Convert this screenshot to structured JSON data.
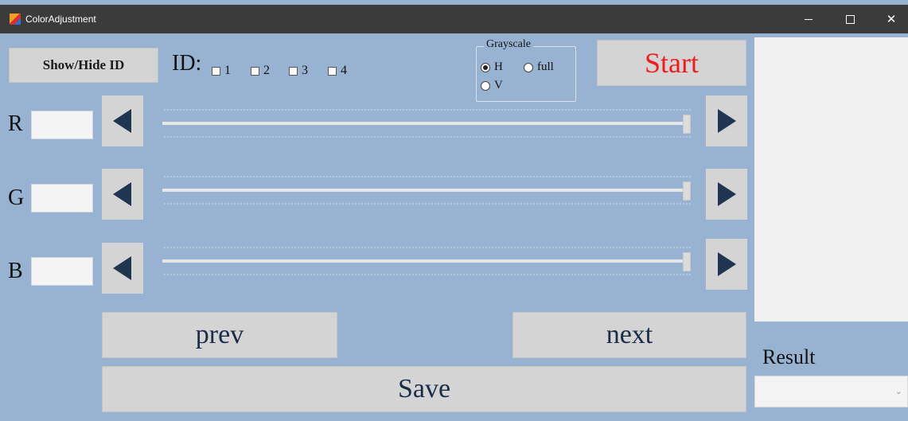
{
  "window": {
    "title": "ColorAdjustment",
    "minimize_glyph": "—",
    "maximize_glyph": "☐",
    "close_glyph": "✕"
  },
  "toolbar": {
    "show_hide_label": "Show/Hide ID",
    "start_label": "Start",
    "start_color": "#ee1c1c"
  },
  "ids": {
    "label": "ID:",
    "options": [
      {
        "label": "1",
        "checked": false
      },
      {
        "label": "2",
        "checked": false
      },
      {
        "label": "3",
        "checked": false
      },
      {
        "label": "4",
        "checked": false
      }
    ]
  },
  "grayscale": {
    "title": "Grayscale",
    "options": [
      {
        "label": "H",
        "selected": true
      },
      {
        "label": "full",
        "selected": false
      },
      {
        "label": "V",
        "selected": false
      }
    ]
  },
  "channels": [
    {
      "label": "R",
      "value": "",
      "slider_fraction": 1.0
    },
    {
      "label": "G",
      "value": "",
      "slider_fraction": 1.0
    },
    {
      "label": "B",
      "value": "",
      "slider_fraction": 1.0
    }
  ],
  "navigation": {
    "prev_label": "prev",
    "next_label": "next",
    "save_label": "Save"
  },
  "result": {
    "label": "Result",
    "selected_value": ""
  },
  "icons": {
    "app": "app-icon",
    "left_arrow": "left-arrow-icon",
    "right_arrow": "right-arrow-icon",
    "dropdown": "chevron-down-icon"
  },
  "colors": {
    "window_bg": "#98b3d1",
    "titlebar_bg": "#3b3b3b",
    "button_bg": "#d4d4d4",
    "arrow_color": "#1f3550"
  }
}
